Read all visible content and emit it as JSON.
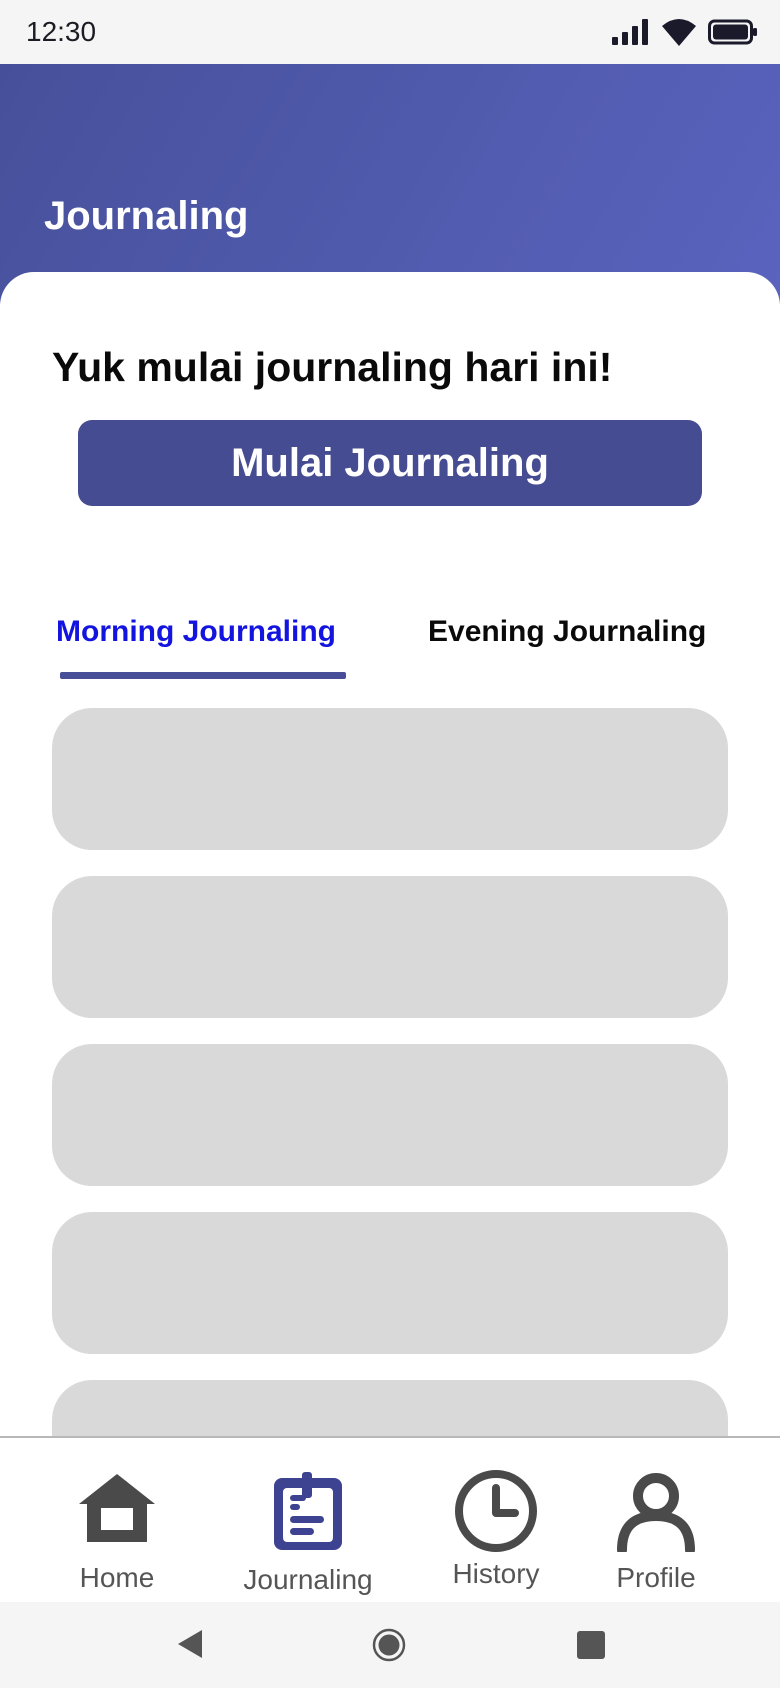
{
  "status_bar": {
    "time": "12:30"
  },
  "header": {
    "title": "Journaling"
  },
  "content": {
    "prompt": "Yuk mulai journaling hari ini!",
    "start_button": "Mulai Journaling",
    "tabs": [
      {
        "label": "Morning Journaling",
        "active": true
      },
      {
        "label": "Evening Journaling",
        "active": false
      }
    ],
    "entry_count": 5
  },
  "bottom_nav": {
    "items": [
      {
        "label": "Home",
        "icon": "home-icon"
      },
      {
        "label": "Journaling",
        "icon": "journal-icon",
        "active": true
      },
      {
        "label": "History",
        "icon": "clock-icon"
      },
      {
        "label": "Profile",
        "icon": "person-icon"
      }
    ]
  },
  "colors": {
    "header_gradient_start": "#46509a",
    "header_gradient_end": "#5a63be",
    "button": "#464c92",
    "active_tab_text": "#1414e0",
    "active_nav_icon": "#3d4391",
    "inactive_nav_icon": "#4a4a4a",
    "skeleton_card": "#d9d9d9"
  }
}
